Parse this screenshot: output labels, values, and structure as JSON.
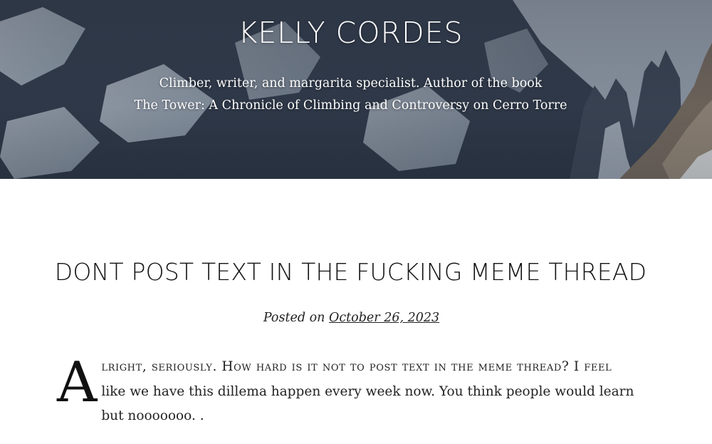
{
  "header": {
    "site_title": "KELLY CORDES",
    "tagline_line1": "Climber, writer, and margarita specialist. Author of the book",
    "tagline_line2": "The Tower: A Chronicle of Climbing and Controversy on Cerro Torre"
  },
  "post": {
    "title": "DONT POST TEXT IN THE FUCKING MEME THREAD",
    "meta_prefix": "Posted on",
    "date": "October 26, 2023",
    "dropcap": "A",
    "first_line": "lright, seriously. How hard is it not to post text in the meme thread? I feel",
    "body_rest": "like we have this dillema happen every week now. You think people would learn but nooooooo. ."
  },
  "colors": {
    "hero_sky": "#8a97a8",
    "text": "#222222",
    "background": "#ffffff"
  }
}
